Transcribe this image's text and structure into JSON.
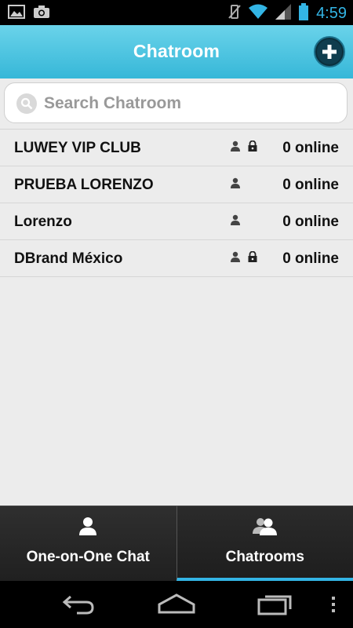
{
  "status_bar": {
    "time": "4:59"
  },
  "header": {
    "title": "Chatroom"
  },
  "search": {
    "placeholder": "Search Chatroom"
  },
  "rooms": [
    {
      "name": "LUWEY VIP CLUB",
      "online": "0 online",
      "locked": true
    },
    {
      "name": "PRUEBA LORENZO",
      "online": "0 online",
      "locked": false
    },
    {
      "name": "Lorenzo",
      "online": "0 online",
      "locked": false
    },
    {
      "name": "DBrand México",
      "online": "0 online",
      "locked": true
    }
  ],
  "tabs": [
    {
      "label": "One-on-One Chat",
      "active": false
    },
    {
      "label": "Chatrooms",
      "active": true
    }
  ],
  "colors": {
    "accent": "#33b5e5",
    "header": "#36b7d8"
  }
}
